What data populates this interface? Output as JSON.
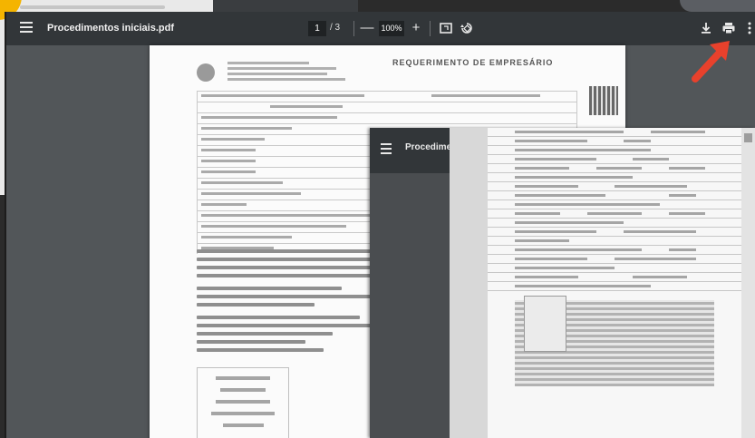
{
  "viewer": {
    "title": "Procedimentos iniciais.pdf",
    "page_current": "1",
    "page_sep": "/ 3",
    "zoom": "100%",
    "zoom_out_label": "—",
    "zoom_in_label": "+",
    "icons": [
      "menu-icon",
      "zoom-out-icon",
      "zoom-in-icon",
      "fit-page-icon",
      "rotate-icon",
      "download-icon",
      "print-icon",
      "more-icon"
    ]
  },
  "document": {
    "header": "REQUERIMENTO DE EMPRESÁRIO"
  },
  "overlay": {
    "title": "Procedimen"
  },
  "colors": {
    "toolbar": "#323639",
    "viewer_bg": "#525659",
    "arrow": "#e8412c",
    "accent_circle": "#f4b400"
  }
}
